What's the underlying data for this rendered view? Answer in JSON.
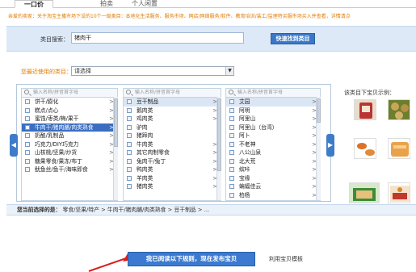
{
  "tabs": [
    {
      "label": "一口价"
    },
    {
      "label": "拍卖"
    },
    {
      "label": "个人闲置"
    }
  ],
  "notice": "亲爱的卖家：关于淘宝主播市场下设的10个一级类目：本地化生活服务、服务市场、网店/网络服务/软件、教育培训/装工/监理特买服市场买入并查看，详情请点",
  "search": {
    "label": "类目搜索：",
    "value": "猪肉干",
    "button": "快速找到类目"
  },
  "recent": {
    "label": "您最近使用的类目：",
    "value": "请选择"
  },
  "columns": [
    {
      "placeholder": "输入名称/拼音首字母",
      "items": [
        {
          "label": "饼干/膨化",
          "arrow": true
        },
        {
          "label": "糕点/点心",
          "arrow": true
        },
        {
          "label": "蜜饯/枣类/梅/果干",
          "arrow": true
        },
        {
          "label": "牛肉干/猪肉脯/肉类熟食",
          "arrow": true,
          "selected": true
        },
        {
          "label": "奶酪/乳制品",
          "arrow": true
        },
        {
          "label": "巧克力/DIY巧克力",
          "arrow": true
        },
        {
          "label": "山核桃/坚果/炒货",
          "arrow": true
        },
        {
          "label": "糖果零食/果冻/布丁",
          "arrow": true
        },
        {
          "label": "鱿鱼丝/鱼干/海味即食",
          "arrow": true
        }
      ]
    },
    {
      "placeholder": "输入名称/拼音首字母",
      "items": [
        {
          "label": "豆干制品",
          "arrow": true,
          "highlight": true
        },
        {
          "label": "鹅肉类",
          "arrow": true
        },
        {
          "label": "鸡肉类",
          "arrow": true
        },
        {
          "label": "驴肉",
          "arrow": false
        },
        {
          "label": "猪蹄肉",
          "arrow": false
        },
        {
          "label": "牛肉类",
          "arrow": true
        },
        {
          "label": "其它肉制零食",
          "arrow": true
        },
        {
          "label": "兔肉干/兔丁",
          "arrow": true
        },
        {
          "label": "鸭肉类",
          "arrow": true
        },
        {
          "label": "羊肉类",
          "arrow": true
        },
        {
          "label": "猪肉类",
          "arrow": true
        }
      ]
    },
    {
      "placeholder": "输入名称/拼音首字母",
      "items": [
        {
          "label": "艾园",
          "arrow": true,
          "highlight": true
        },
        {
          "label": "阿明",
          "arrow": true
        },
        {
          "label": "阿里山",
          "arrow": true
        },
        {
          "label": "阿里山（台湾）",
          "arrow": true
        },
        {
          "label": "阿卜",
          "arrow": true
        },
        {
          "label": "不老神",
          "arrow": true
        },
        {
          "label": "八公山泉",
          "arrow": true
        },
        {
          "label": "北大荒",
          "arrow": true
        },
        {
          "label": "缤咔",
          "arrow": true
        },
        {
          "label": "宝缘",
          "arrow": true
        },
        {
          "label": "蝙蝠佳云",
          "arrow": true
        },
        {
          "label": "柏杨",
          "arrow": true
        }
      ]
    }
  ],
  "sample": {
    "title": "该类目下宝贝示例："
  },
  "path": {
    "label": "您当前选择的是：",
    "value": "零食/坚果/特产 > 牛肉干/猪肉脯/肉类熟食 > 豆干制品 > ..."
  },
  "publish_button": "我已阅读以下规则，现在发布宝贝",
  "alt_link": "利用宝贝模板"
}
